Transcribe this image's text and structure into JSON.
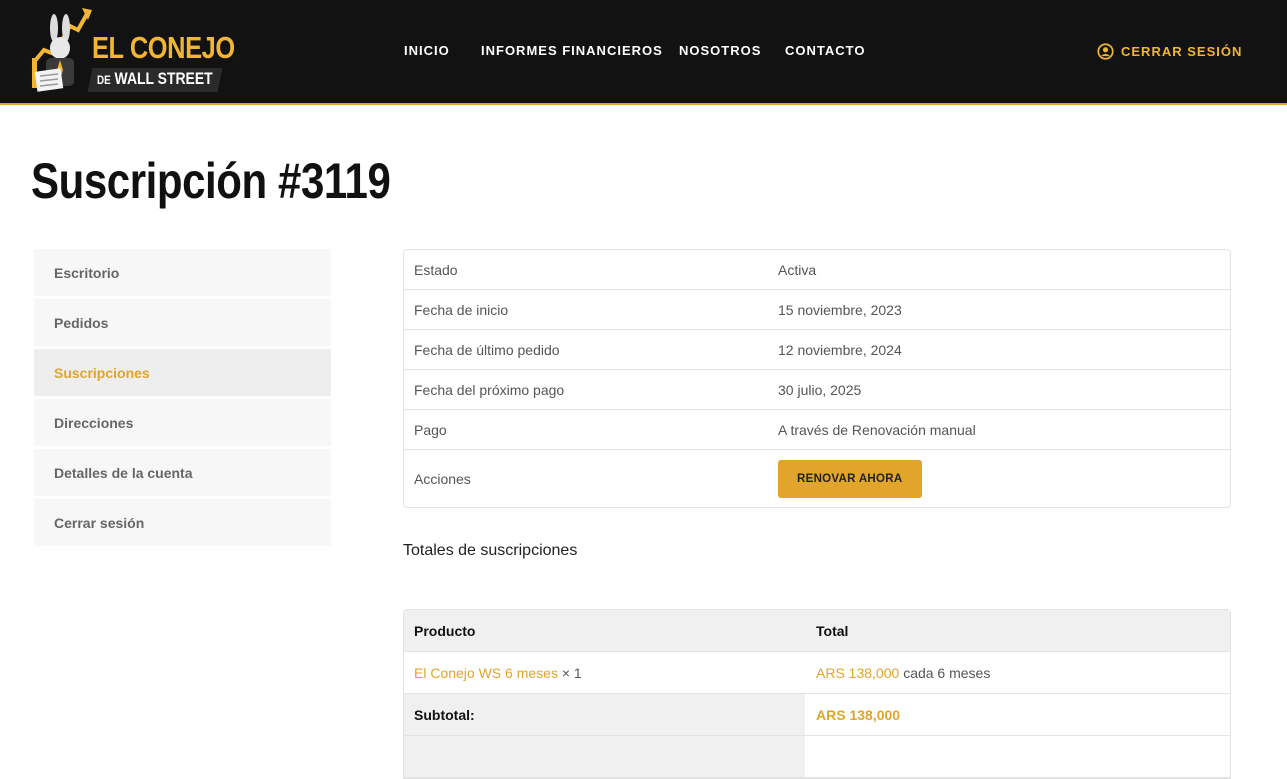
{
  "brand": {
    "line1": "EL CONEJO",
    "line2_prefix": "DE",
    "line2_main": "WALL STREET",
    "accent_color": "#f2b632"
  },
  "nav": {
    "items": [
      {
        "label": "INICIO"
      },
      {
        "label": "INFORMES FINANCIEROS"
      },
      {
        "label": "NOSOTROS"
      },
      {
        "label": "CONTACTO"
      }
    ],
    "logout_label": "CERRAR SESIÓN"
  },
  "page": {
    "title": "Suscripción #3119"
  },
  "sidebar": {
    "items": [
      {
        "label": "Escritorio"
      },
      {
        "label": "Pedidos"
      },
      {
        "label": "Suscripciones",
        "active": true
      },
      {
        "label": "Direcciones"
      },
      {
        "label": "Detalles de la cuenta"
      },
      {
        "label": "Cerrar sesión"
      }
    ]
  },
  "subscription": {
    "rows": [
      {
        "label": "Estado",
        "value": "Activa"
      },
      {
        "label": "Fecha de inicio",
        "value": "15 noviembre, 2023"
      },
      {
        "label": "Fecha de último pedido",
        "value": "12 noviembre, 2024"
      },
      {
        "label": "Fecha del próximo pago",
        "value": "30 julio, 2025"
      },
      {
        "label": "Pago",
        "value": "A través de Renovación manual"
      }
    ],
    "actions_label": "Acciones",
    "renew_button": "RENOVAR AHORA"
  },
  "totals": {
    "heading": "Totales de suscripciones",
    "col_product": "Producto",
    "col_total": "Total",
    "item_name": "El Conejo WS 6 meses",
    "item_qty": "× 1",
    "item_price": "ARS 138,000",
    "item_period": "cada 6 meses",
    "subtotal_label": "Subtotal:",
    "subtotal_value": "ARS 138,000"
  }
}
